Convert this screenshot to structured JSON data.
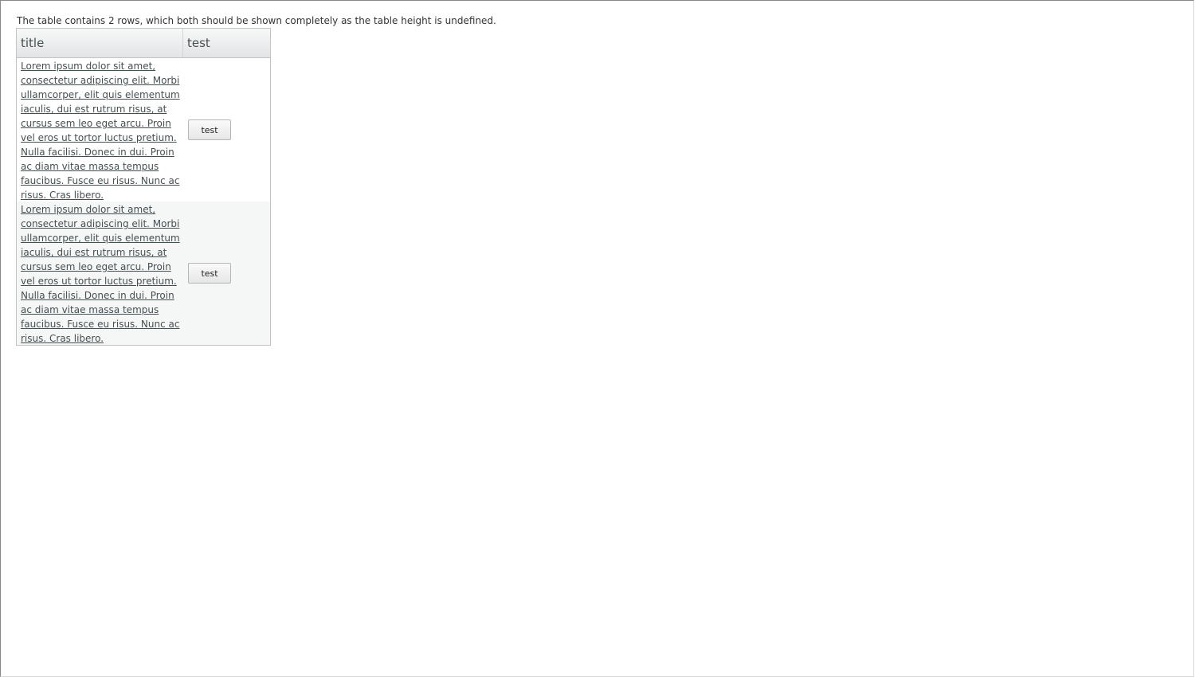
{
  "description": "The table contains 2 rows, which both should be shown completely as the table height is undefined.",
  "table": {
    "headers": {
      "title": "title",
      "test": "test"
    },
    "rows": [
      {
        "title": "Lorem ipsum dolor sit amet, consectetur adipiscing elit. Morbi ullamcorper, elit quis elementum iaculis, dui est rutrum risus, at cursus sem leo eget arcu. Proin vel eros ut tortor luctus pretium. Nulla facilisi. Donec in dui. Proin ac diam vitae massa tempus faucibus. Fusce eu risus. Nunc ac risus. Cras libero.",
        "button": "test"
      },
      {
        "title": "Lorem ipsum dolor sit amet, consectetur adipiscing elit. Morbi ullamcorper, elit quis elementum iaculis, dui est rutrum risus, at cursus sem leo eget arcu. Proin vel eros ut tortor luctus pretium. Nulla facilisi. Donec in dui. Proin ac diam vitae massa tempus faucibus. Fusce eu risus. Nunc ac risus. Cras libero.",
        "button": "test"
      }
    ]
  }
}
